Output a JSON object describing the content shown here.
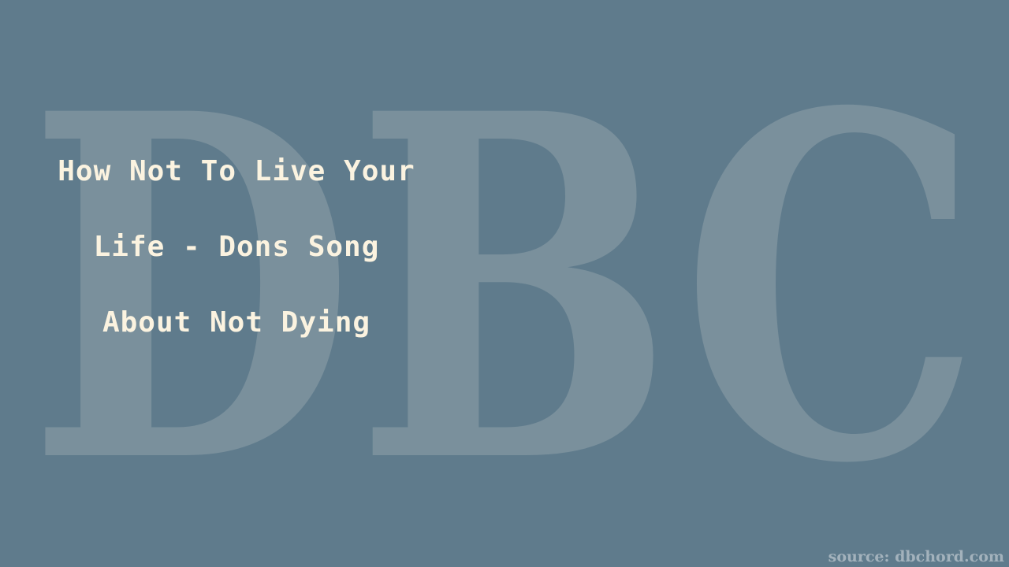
{
  "watermark": {
    "text": "DBC",
    "color": "#7a909c"
  },
  "title": {
    "lines": [
      "How Not To Live Your",
      "Life - Dons Song",
      "About Not Dying"
    ],
    "color": "#fbf3e0"
  },
  "source": {
    "text": "source: dbchord.com"
  },
  "background_color": "#5f7b8c"
}
